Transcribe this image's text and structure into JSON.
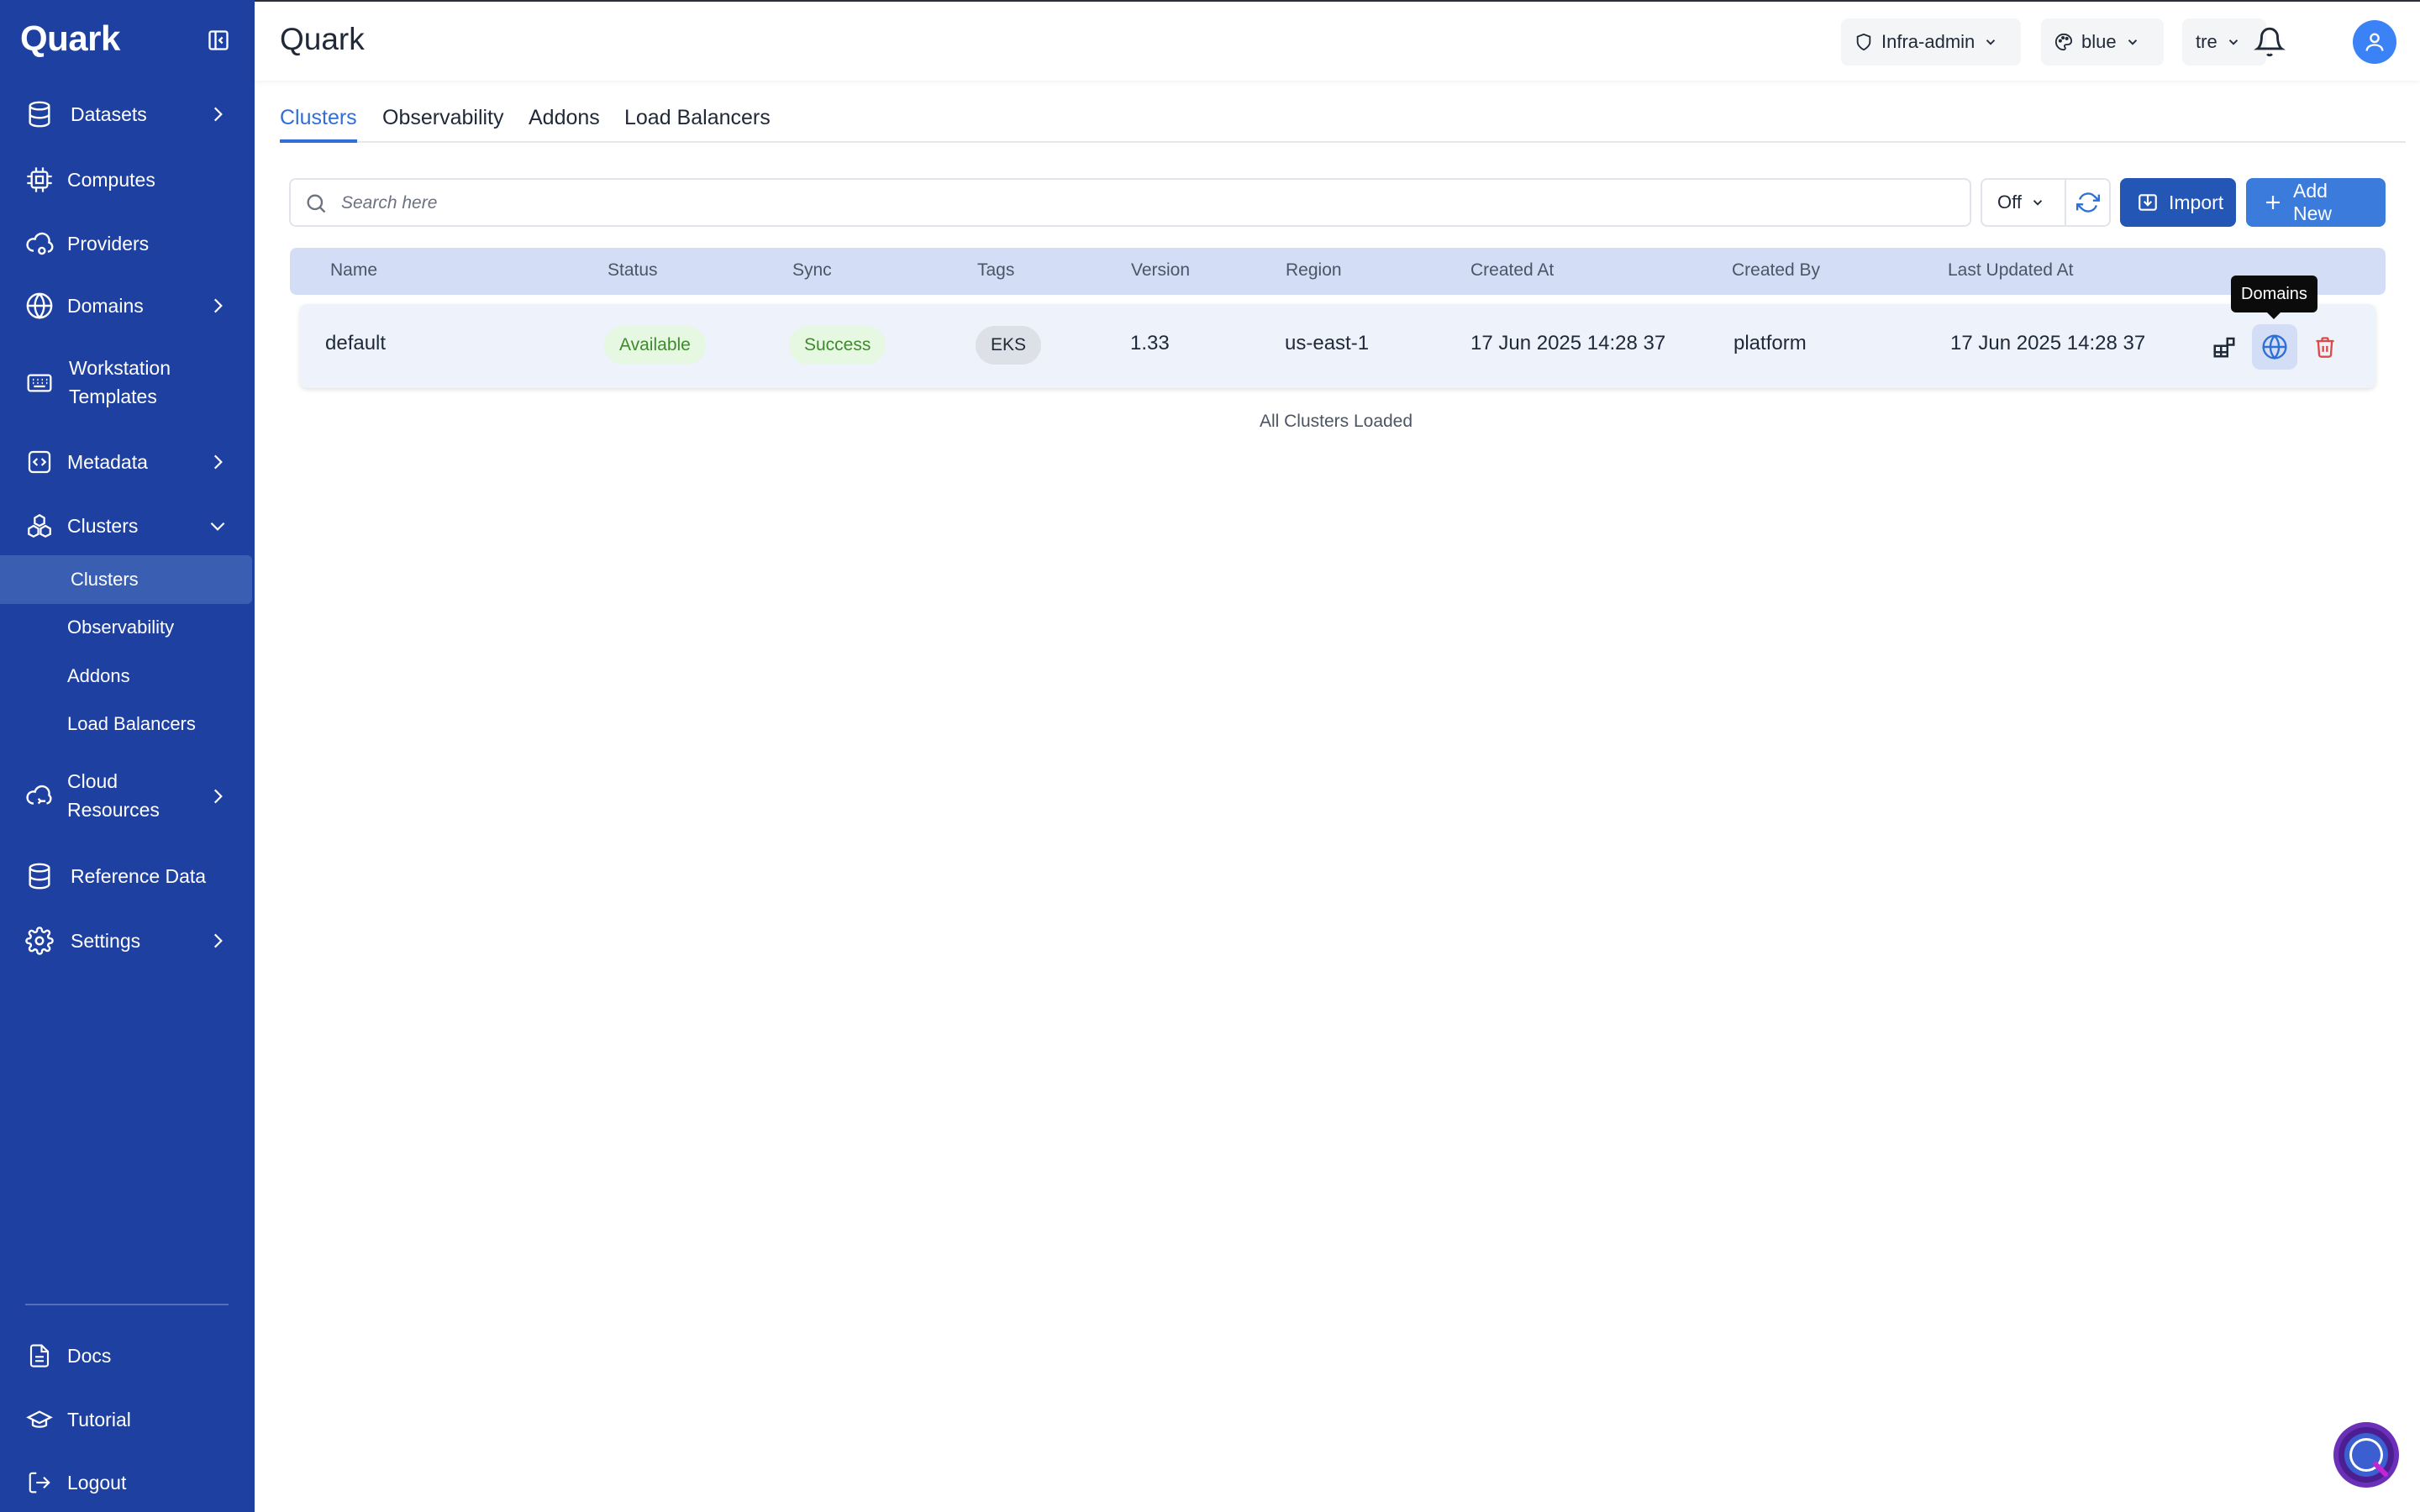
{
  "app": {
    "brand": "Quark",
    "page_title": "Quark"
  },
  "sidebar": {
    "items": [
      {
        "label": "Datasets",
        "icon": "database-icon",
        "has_chevron": true
      },
      {
        "label": "Computes",
        "icon": "chip-icon"
      },
      {
        "label": "Providers",
        "icon": "cloud-icon"
      },
      {
        "label": "Domains",
        "icon": "globe-icon",
        "has_chevron": true
      },
      {
        "label": "Workstation",
        "label2": "Templates",
        "icon": "keyboard-icon"
      },
      {
        "label": "Metadata",
        "icon": "code-icon",
        "has_chevron": true
      },
      {
        "label": "Clusters",
        "icon": "cluster-icon",
        "expanded": true
      },
      {
        "label": "Cloud",
        "label2": "Resources",
        "icon": "cloud-sync-icon",
        "has_chevron": true
      },
      {
        "label": "Reference Data",
        "icon": "database-icon"
      },
      {
        "label": "Settings",
        "icon": "gear-icon",
        "has_chevron": true
      }
    ],
    "sub_items": [
      {
        "label": "Clusters",
        "active": true
      },
      {
        "label": "Observability"
      },
      {
        "label": "Addons"
      },
      {
        "label": "Load Balancers"
      }
    ],
    "footer": [
      {
        "label": "Docs",
        "icon": "document-icon"
      },
      {
        "label": "Tutorial",
        "icon": "graduation-cap-icon"
      },
      {
        "label": "Logout",
        "icon": "logout-icon"
      }
    ]
  },
  "header": {
    "role": "Infra-admin",
    "theme": "blue",
    "tenant": "tre"
  },
  "tabs": [
    "Clusters",
    "Observability",
    "Addons",
    "Load Balancers"
  ],
  "toolbar": {
    "search_placeholder": "Search here",
    "auto_refresh": "Off",
    "import_label": "Import",
    "add_new_label": "Add New"
  },
  "table": {
    "columns": [
      "Name",
      "Status",
      "Sync",
      "Tags",
      "Version",
      "Region",
      "Created At",
      "Created By",
      "Last Updated At"
    ],
    "rows": [
      {
        "name": "default",
        "status": "Available",
        "sync": "Success",
        "tags": "EKS",
        "version": "1.33",
        "region": "us-east-1",
        "created_at": "17 Jun 2025 14:28 37",
        "created_by": "platform",
        "last_updated_at": "17 Jun 2025 14:28 37"
      }
    ],
    "tooltip": "Domains",
    "footer_text": "All Clusters Loaded"
  },
  "colors": {
    "sidebar_bg": "#1e40a0",
    "primary": "#2f6fd6",
    "import_bg": "#2356b5",
    "success_bg": "#e6f8e1",
    "success_text": "#3f8a2e",
    "danger": "#e04848"
  }
}
